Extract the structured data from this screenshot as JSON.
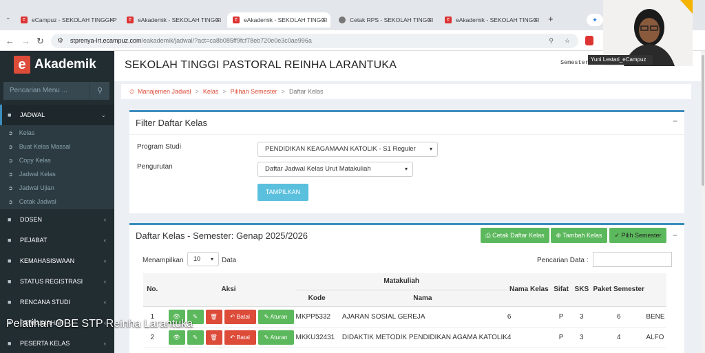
{
  "browser": {
    "tabs": [
      {
        "title": "eCampuz - SEKOLAH TINGGI P",
        "active": false
      },
      {
        "title": "eAkademik - SEKOLAH TINGGI",
        "active": false
      },
      {
        "title": "eAkademik - SEKOLAH TINGGI",
        "active": true
      },
      {
        "title": "Cetak RPS - SEKOLAH TINGGI",
        "active": false
      },
      {
        "title": "eAkademik - SEKOLAH TINGGI",
        "active": false
      }
    ],
    "new_tab": "+",
    "url_host": "stprenya-lrt.ecampuz.com",
    "url_path": "/eakademik/jadwal/?act=ca8b085ff9fcf78eb720e0e3c0ae996a"
  },
  "sidebar": {
    "logo_letter": "e",
    "logo_text": "Akademik",
    "search_placeholder": "Pencarian Menu ...",
    "menus": [
      {
        "label": "JADWAL",
        "open": true
      },
      {
        "label": "DOSEN"
      },
      {
        "label": "PEJABAT"
      },
      {
        "label": "KEMAHASISWAAN"
      },
      {
        "label": "STATUS REGISTRASI"
      },
      {
        "label": "RENCANA STUDI"
      },
      {
        "label": "PERKULIAHAN"
      },
      {
        "label": "PESERTA KELAS"
      }
    ],
    "jadwal_items": [
      "Kelas",
      "Buat Kelas Massal",
      "Copy Kelas",
      "Jadwal Kelas",
      "Jadwal Ujian",
      "Cetak Jadwal"
    ]
  },
  "header": {
    "institution": "SEKOLAH TINGGI PASTORAL REINHA LARANTUKA",
    "semester_label": "Semester Genap 2025/2026"
  },
  "breadcrumb": [
    "Manajemen Jadwal",
    "Kelas",
    "Pilihan Semester",
    "Daftar Kelas"
  ],
  "filter": {
    "title": "Filter Daftar Kelas",
    "program_label": "Program Studi",
    "program_value": "PENDIDIKAN KEAGAMAAN KATOLIK - S1 Reguler",
    "order_label": "Pengurutan",
    "order_value": "Daftar Jadwal Kelas Urut Matakuliah",
    "submit": "TAMPILKAN"
  },
  "list": {
    "title": "Daftar Kelas - Semester: Genap 2025/2026",
    "btn_print": "Cetak Daftar Kelas",
    "btn_add": "Tambah Kelas",
    "btn_choose": "Pilih Semester",
    "show_prefix": "Menampilkan",
    "show_value": "10",
    "show_suffix": "Data",
    "search_label": "Pencarian Data :",
    "columns": {
      "no": "No.",
      "aksi": "Aksi",
      "matakuliah": "Matakuliah",
      "kode": "Kode",
      "nama": "Nama",
      "nama_kelas": "Nama Kelas",
      "sifat": "Sifat",
      "sks": "SKS",
      "paket": "Paket Semester"
    },
    "action_labels": {
      "batal": "Batal",
      "aturan": "Aturan"
    },
    "rows": [
      {
        "no": "1",
        "kode": "MKPP5332",
        "nama": "AJARAN SOSIAL GEREJA",
        "kelas": "6",
        "sifat": "P",
        "sks": "3",
        "paket": "6",
        "dosen": "BENE"
      },
      {
        "no": "2",
        "kode": "MKKU32431",
        "nama": "DIDAKTIK METODIK PENDIDIKAN AGAMA KATOLIK",
        "kelas": "4",
        "sifat": "P",
        "sks": "3",
        "paket": "4",
        "dosen": "ALFO"
      }
    ]
  },
  "video": {
    "caption": "Pelatihan OBE STP Reinha Larantuka",
    "participant": "Yuni Lestari_eCampuz"
  }
}
